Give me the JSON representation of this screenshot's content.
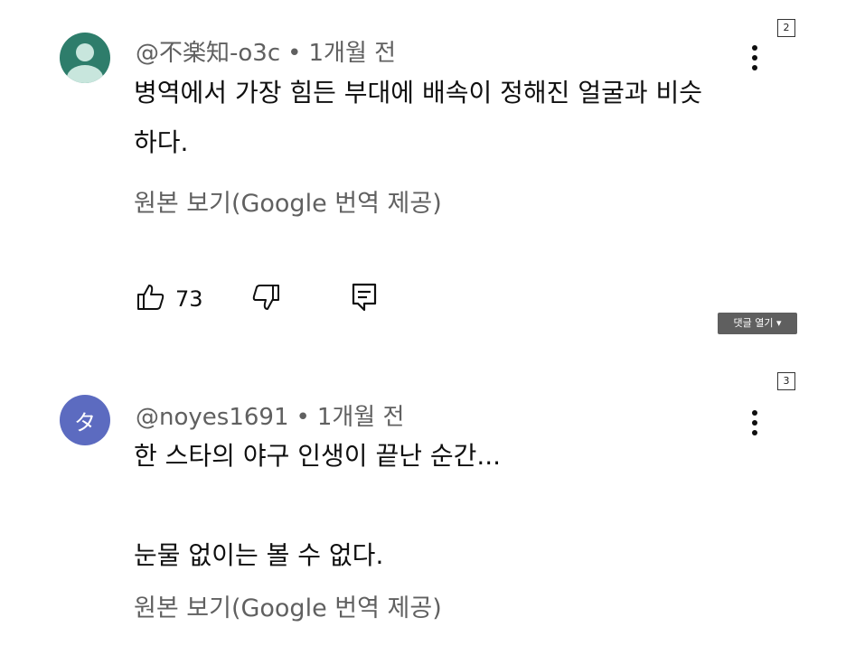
{
  "comments": [
    {
      "index": "2",
      "handle": "@不楽知-o3c",
      "separator": "•",
      "time": "1개월 전",
      "text": "병역에서 가장 힘든 부대에 배속이 정해진 얼굴과 비슷\n하다.",
      "translate_label": "원본 보기(Google 번역 제공)",
      "like_count": "73",
      "avatar_color": "#2e7d6b",
      "avatar_icon": "person-icon"
    },
    {
      "index": "3",
      "handle": "@noyes1691",
      "separator": "•",
      "time": "1개월 전",
      "avatar_letter": "タ",
      "avatar_color": "#5c6bc0",
      "text": "한 스타의 야구 인생이 끝난 순간...\n\n눈물 없이는 볼 수 없다.",
      "translate_label": "원본 보기(Google 번역 제공)"
    }
  ],
  "reply_toggle": "댓글 열기 ▾"
}
